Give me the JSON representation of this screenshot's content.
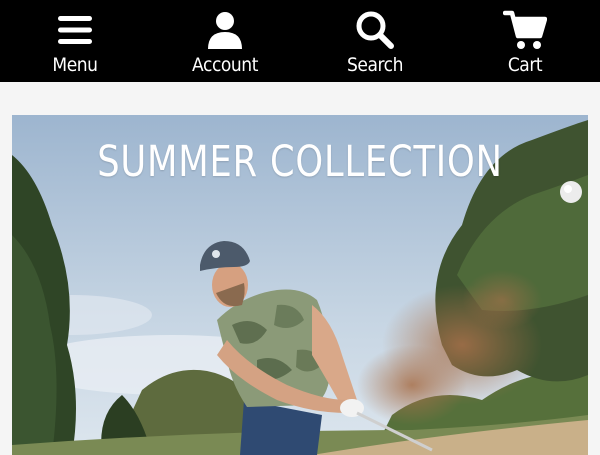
{
  "nav": {
    "items": [
      {
        "label": "Menu",
        "icon": "hamburger-menu-icon"
      },
      {
        "label": "Account",
        "icon": "user-icon"
      },
      {
        "label": "Search",
        "icon": "search-icon"
      },
      {
        "label": "Cart",
        "icon": "shopping-cart-icon"
      }
    ]
  },
  "banner": {
    "title": "SUMMER COLLECTION"
  },
  "colors": {
    "nav_background": "#000000",
    "nav_text": "#ffffff",
    "page_background": "#f5f5f5"
  }
}
